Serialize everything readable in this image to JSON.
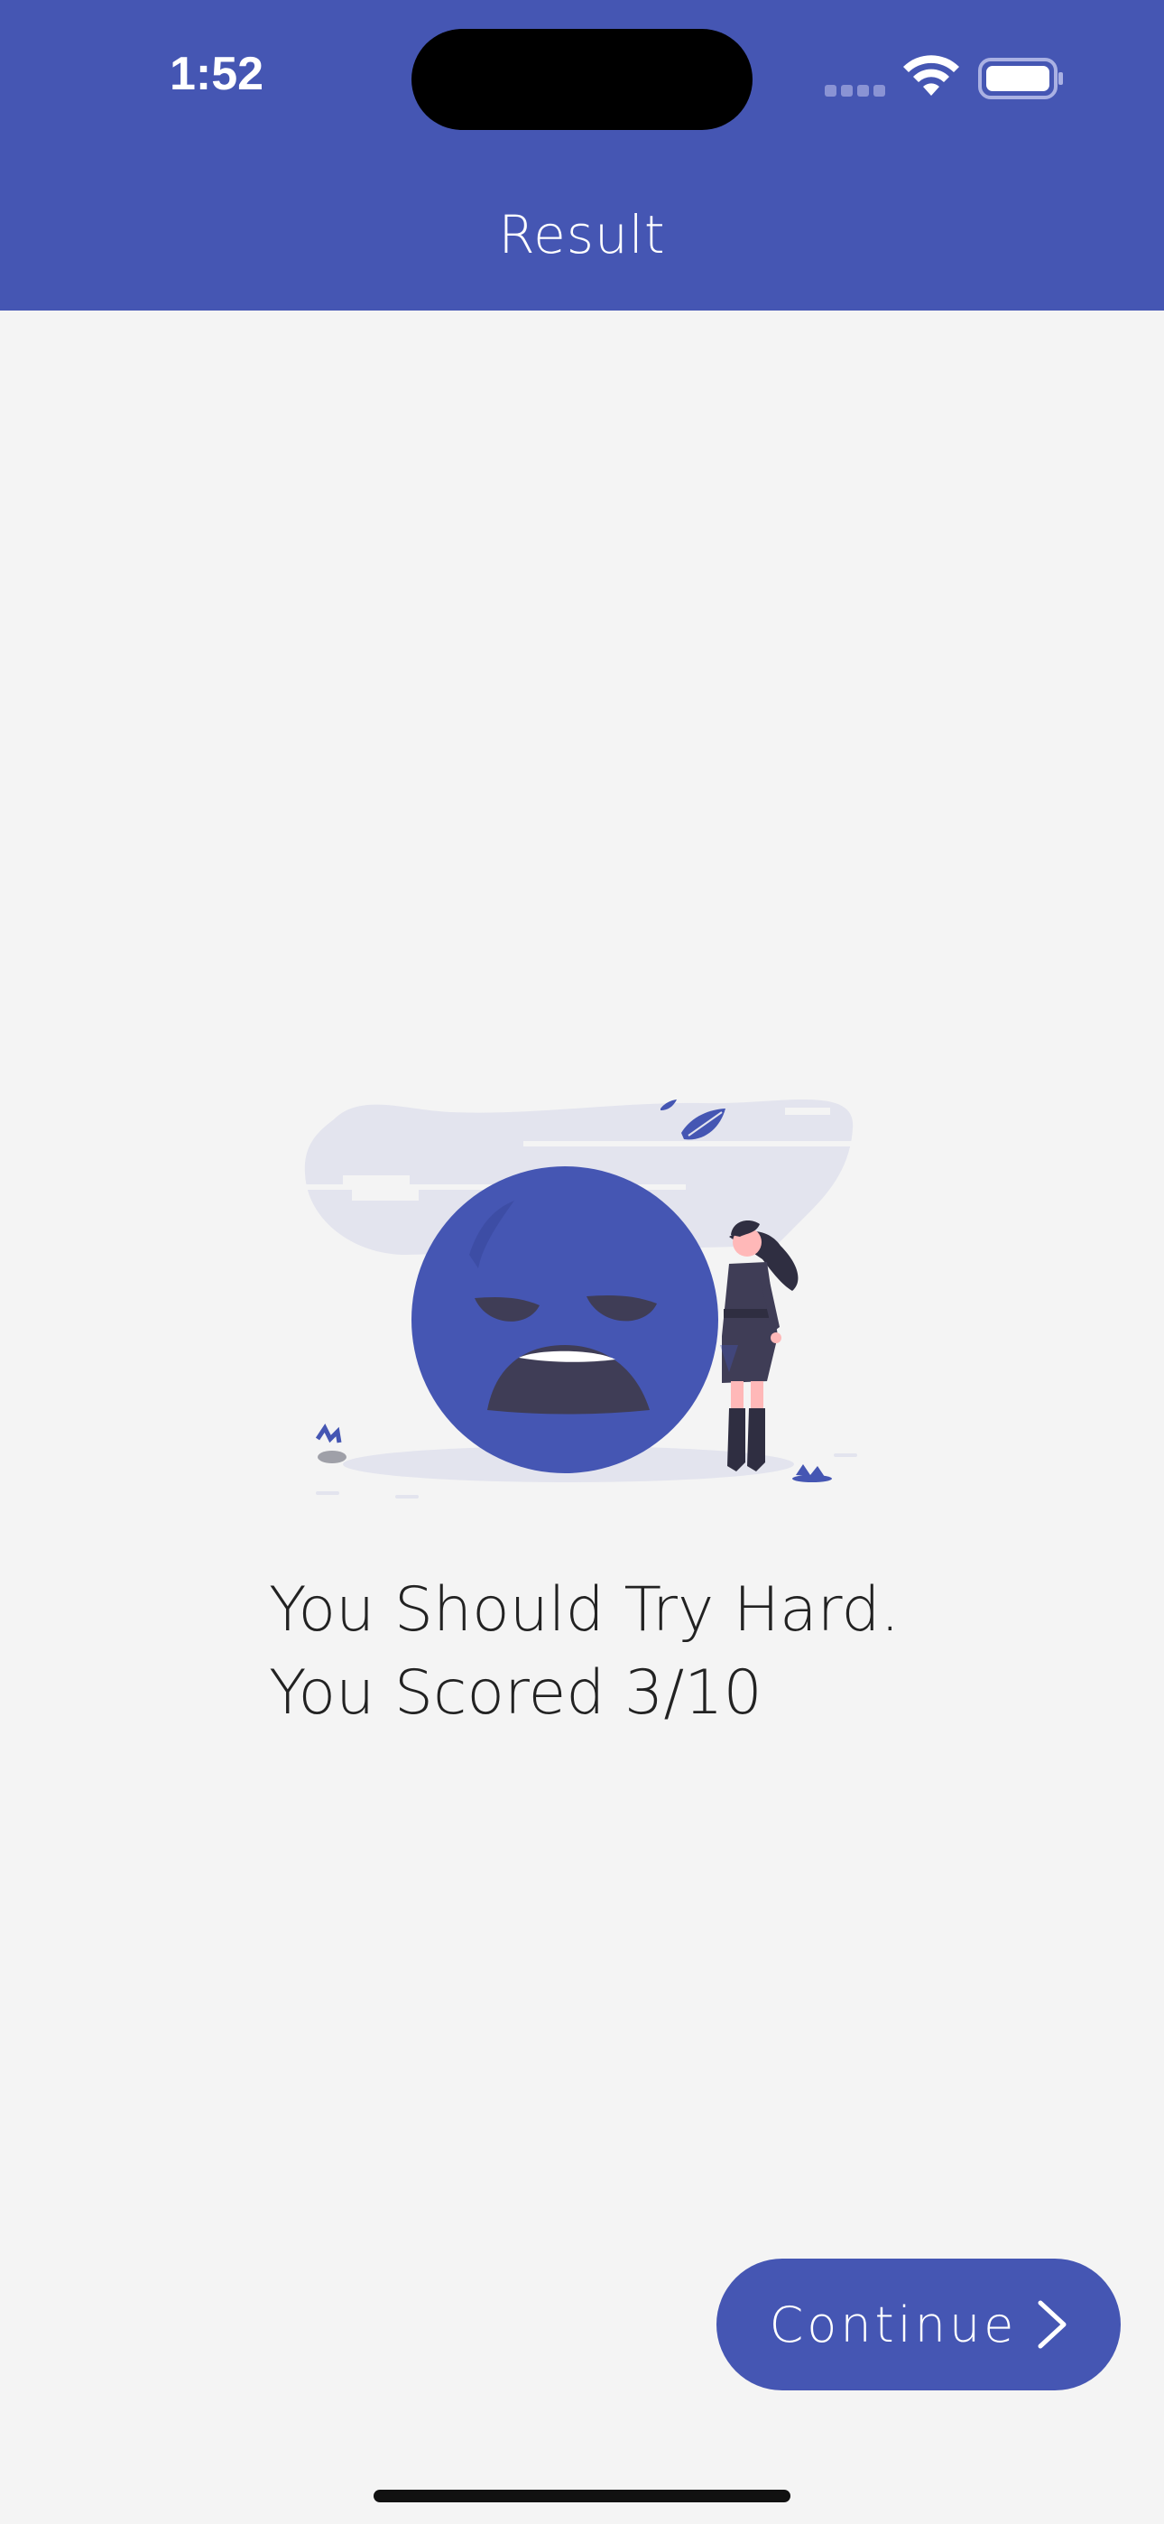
{
  "status_bar": {
    "time": "1:52",
    "icons": [
      "signal-icon",
      "wifi-icon",
      "battery-icon"
    ]
  },
  "header": {
    "title": "Result"
  },
  "result": {
    "line1": "You Should Try Hard.",
    "line2": "You Scored 3/10",
    "illustration_icon": "sad-face-illustration"
  },
  "actions": {
    "continue_label": "Continue",
    "continue_icon": "chevron-right-icon"
  },
  "colors": {
    "primary": "#4556b3",
    "background": "#f4f4f4",
    "text": "#222222"
  }
}
